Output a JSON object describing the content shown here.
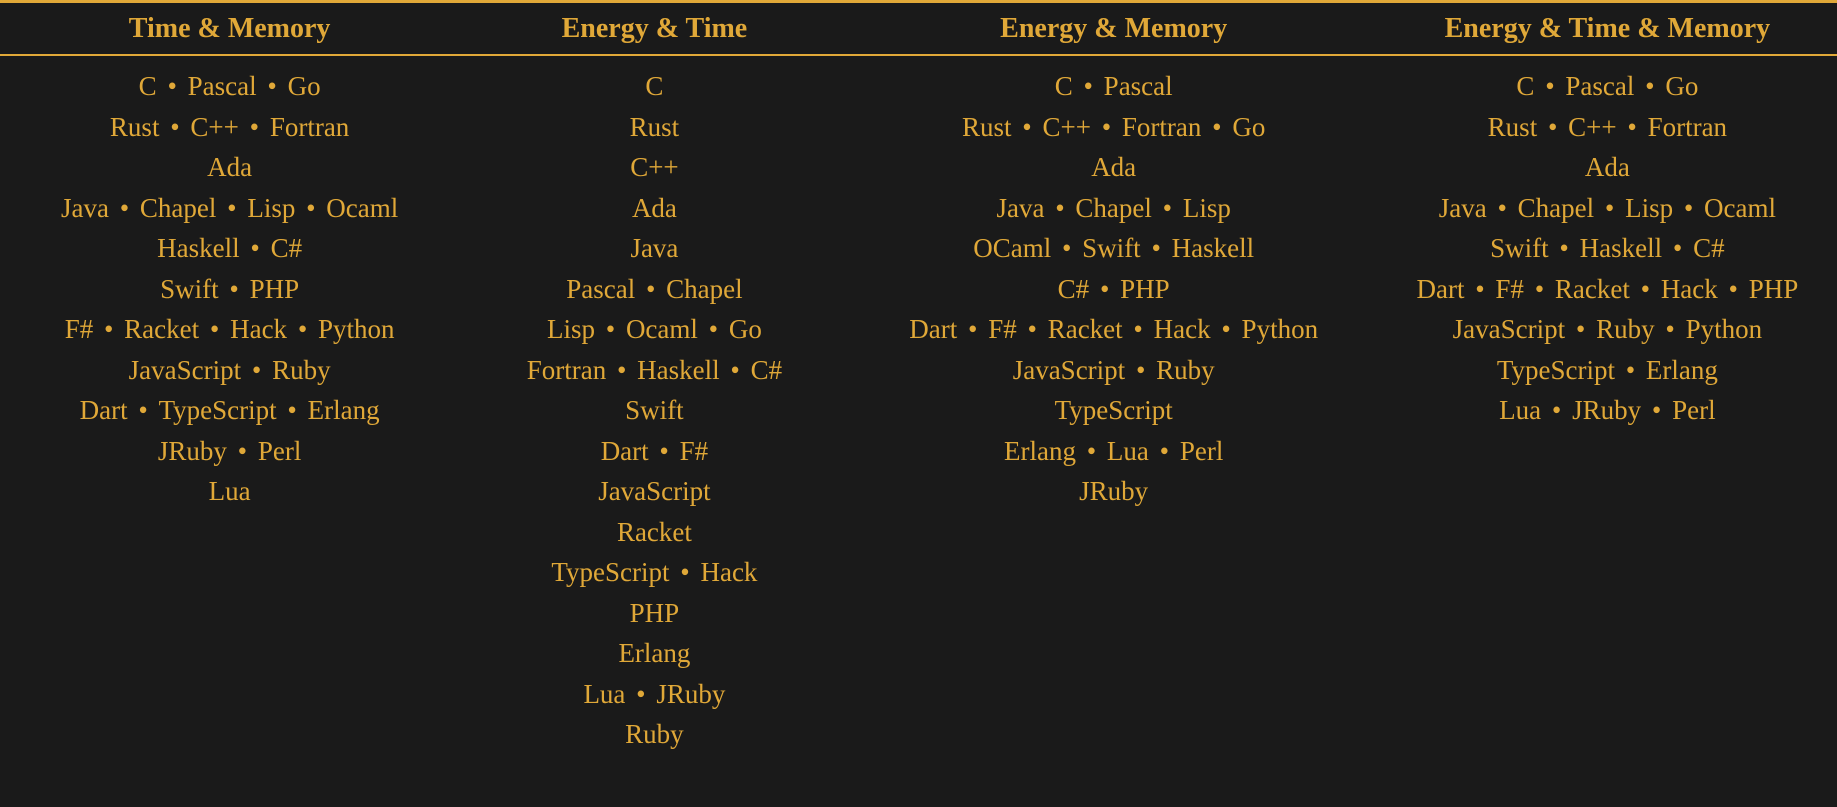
{
  "columns": [
    {
      "header": "Time & Memory",
      "rows": [
        [
          "C",
          "Pascal",
          "Go"
        ],
        [
          "Rust",
          "C++",
          "Fortran"
        ],
        [
          "Ada"
        ],
        [
          "Java",
          "Chapel",
          "Lisp",
          "Ocaml"
        ],
        [
          "Haskell",
          "C#"
        ],
        [
          "Swift",
          "PHP"
        ],
        [
          "F#",
          "Racket",
          "Hack",
          "Python"
        ],
        [
          "JavaScript",
          "Ruby"
        ],
        [
          "Dart",
          "TypeScript",
          "Erlang"
        ],
        [
          "JRuby",
          "Perl"
        ],
        [
          "Lua"
        ]
      ]
    },
    {
      "header": "Energy & Time",
      "rows": [
        [
          "C"
        ],
        [
          "Rust"
        ],
        [
          "C++"
        ],
        [
          "Ada"
        ],
        [
          "Java"
        ],
        [
          "Pascal",
          "Chapel"
        ],
        [
          "Lisp",
          "Ocaml",
          "Go"
        ],
        [
          "Fortran",
          "Haskell",
          "C#"
        ],
        [
          "Swift"
        ],
        [
          "Dart",
          "F#"
        ],
        [
          "JavaScript"
        ],
        [
          "Racket"
        ],
        [
          "TypeScript",
          "Hack"
        ],
        [
          "PHP"
        ],
        [
          "Erlang"
        ],
        [
          "Lua",
          "JRuby"
        ],
        [
          "Ruby"
        ]
      ]
    },
    {
      "header": "Energy & Memory",
      "rows": [
        [
          "C",
          "Pascal"
        ],
        [
          "Rust",
          "C++",
          "Fortran",
          "Go"
        ],
        [
          "Ada"
        ],
        [
          "Java",
          "Chapel",
          "Lisp"
        ],
        [
          "OCaml",
          "Swift",
          "Haskell"
        ],
        [
          "C#",
          "PHP"
        ],
        [
          "Dart",
          "F#",
          "Racket",
          "Hack",
          "Python"
        ],
        [
          "JavaScript",
          "Ruby"
        ],
        [
          "TypeScript"
        ],
        [
          "Erlang",
          "Lua",
          "Perl"
        ],
        [
          "JRuby"
        ]
      ]
    },
    {
      "header": "Energy & Time & Memory",
      "rows": [
        [
          "C",
          "Pascal",
          "Go"
        ],
        [
          "Rust",
          "C++",
          "Fortran"
        ],
        [
          "Ada"
        ],
        [
          "Java",
          "Chapel",
          "Lisp",
          "Ocaml"
        ],
        [
          "Swift",
          "Haskell",
          "C#"
        ],
        [
          "Dart",
          "F#",
          "Racket",
          "Hack",
          "PHP"
        ],
        [
          "JavaScript",
          "Ruby",
          "Python"
        ],
        [
          "TypeScript",
          "Erlang"
        ],
        [
          "Lua",
          "JRuby",
          "Perl"
        ]
      ]
    }
  ],
  "bullet": "•"
}
